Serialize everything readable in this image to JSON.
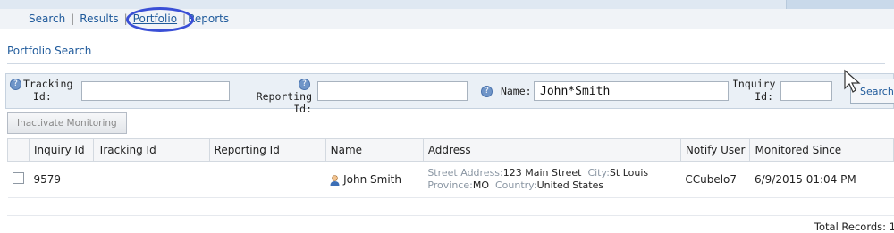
{
  "nav": {
    "items": [
      "Search",
      "Results",
      "Portfolio",
      "Reports"
    ],
    "active": "Portfolio"
  },
  "page": {
    "subtitle": "Portfolio Search"
  },
  "search": {
    "tracking_label_1": "Tracking",
    "tracking_label_2": "Id:",
    "tracking_value": "",
    "reporting_label_1": "Reporting",
    "reporting_label_2": "Id:",
    "reporting_value": "",
    "name_label": "Name:",
    "name_value": "John*Smith",
    "inquiry_label_1": "Inquiry",
    "inquiry_label_2": "Id:",
    "inquiry_value": "",
    "search_button": "Search"
  },
  "toolbar": {
    "inactivate_button": "Inactivate Monitoring"
  },
  "table": {
    "columns": [
      "",
      "Inquiry Id",
      "Tracking Id",
      "Reporting Id",
      "Name",
      "Address",
      "Notify User",
      "Monitored Since"
    ],
    "rows": [
      {
        "checked": false,
        "inquiry_id": "9579",
        "tracking_id": "",
        "reporting_id": "",
        "name": "John Smith",
        "street_key": "Street Address:",
        "street_val": "123 Main Street",
        "city_key": "City:",
        "city_val": "St Louis",
        "province_key": "Province:",
        "province_val": "MO",
        "country_key": "Country:",
        "country_val": "United States",
        "notify_user": "CCubelo7",
        "monitored_since": "6/9/2015 01:04 PM"
      }
    ]
  },
  "footer": {
    "total_records": "Total Records: 1"
  },
  "icons": {
    "help": "help-icon",
    "user": "user-icon",
    "cursor": "mouse-cursor-icon"
  },
  "colors": {
    "link": "#1f5a9b",
    "annotation_circle": "#3a4fd6",
    "search_bar_bg": "#eaf0f6"
  }
}
